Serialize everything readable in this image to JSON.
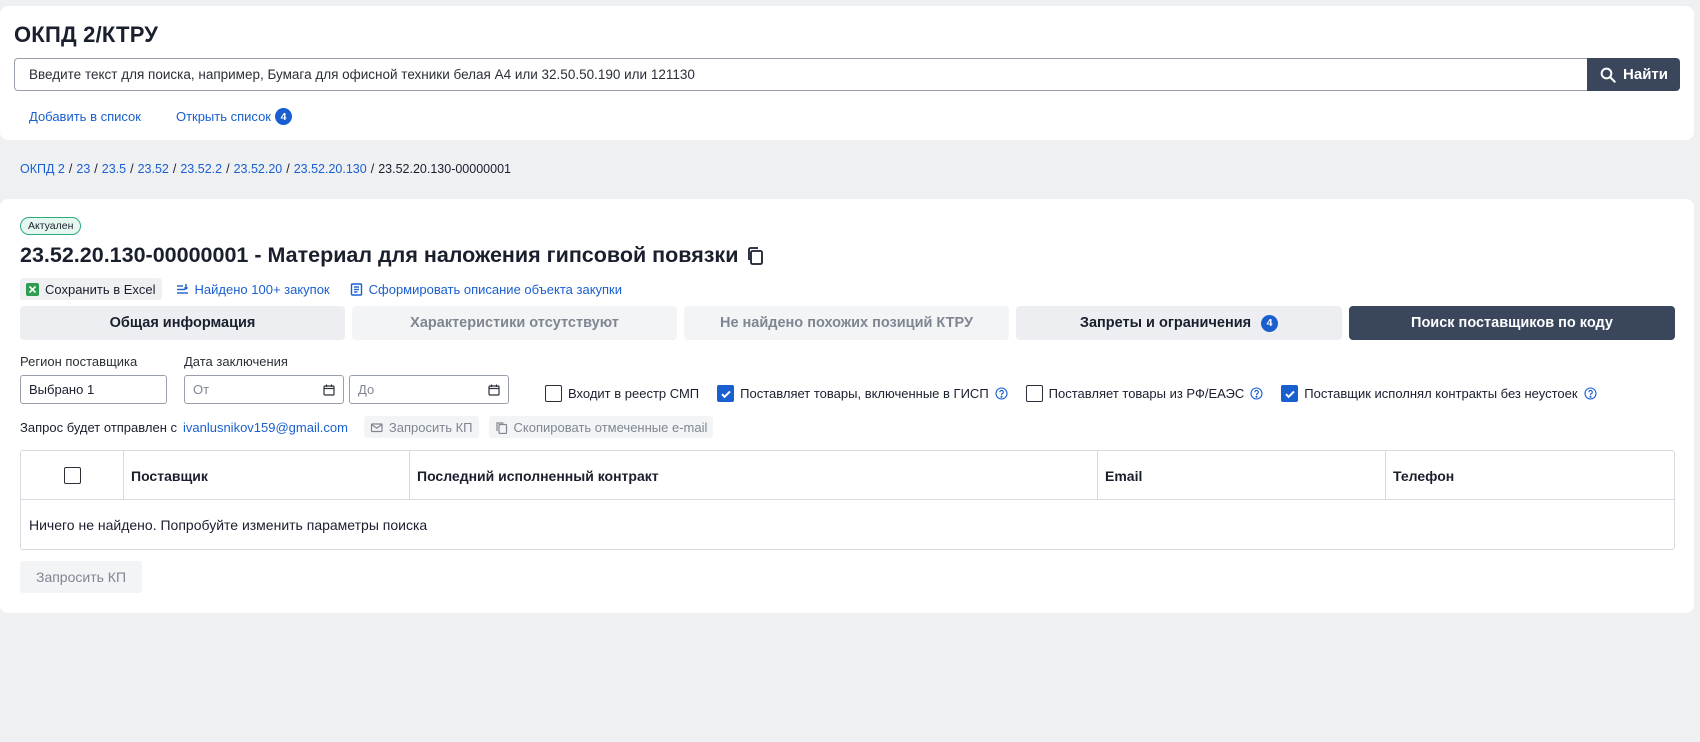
{
  "header": {
    "title": "ОКПД 2/КТРУ",
    "search_placeholder": "Введите текст для поиска, например, Бумага для офисной техники белая А4 или 32.50.50.190 или 121130",
    "search_button": "Найти",
    "add_to_list": "Добавить в список",
    "open_list": "Открыть список",
    "list_count": "4"
  },
  "breadcrumb": {
    "items": [
      "ОКПД 2",
      "23",
      "23.5",
      "23.52",
      "23.52.2",
      "23.52.20",
      "23.52.20.130"
    ],
    "current": "23.52.20.130-00000001"
  },
  "item": {
    "status": "Актуален",
    "title": "23.52.20.130-00000001 - Материал для наложения гипсовой повязки",
    "actions": {
      "excel": "Сохранить в Excel",
      "found": "Найдено 100+ закупок",
      "describe": "Сформировать описание объекта закупки"
    }
  },
  "tabs": [
    {
      "label": "Общая информация"
    },
    {
      "label": "Характеристики отсутствуют"
    },
    {
      "label": "Не найдено похожих позиций КТРУ"
    },
    {
      "label": "Запреты и ограничения",
      "badge": "4"
    },
    {
      "label": "Поиск поставщиков по коду"
    }
  ],
  "filters": {
    "region_label": "Регион поставщика",
    "region_value": "Выбрано 1",
    "date_label": "Дата заключения",
    "date_from_placeholder": "От",
    "date_to_placeholder": "До",
    "checkboxes": [
      {
        "label": "Входит в реестр СМП",
        "checked": false
      },
      {
        "label": "Поставляет товары, включенные в ГИСП",
        "checked": true
      },
      {
        "label": "Поставляет товары из РФ/ЕАЭС",
        "checked": false
      },
      {
        "label": "Поставщик исполнял контракты без неустоек",
        "checked": true
      }
    ]
  },
  "request": {
    "prefix": "Запрос будет отправлен с",
    "email": "ivanlusnikov159@gmail.com",
    "request_kp": "Запросить КП",
    "copy_emails": "Скопировать отмеченные e-mail"
  },
  "table": {
    "columns": [
      "Поставщик",
      "Последний исполненный контракт",
      "Email",
      "Телефон"
    ],
    "empty": "Ничего не найдено. Попробуйте изменить параметры поиска"
  },
  "bottom_button": "Запросить КП",
  "colors": {
    "accent": "#1a5fd0",
    "dark": "#3a465c",
    "status_green": "#2eaa7a"
  }
}
